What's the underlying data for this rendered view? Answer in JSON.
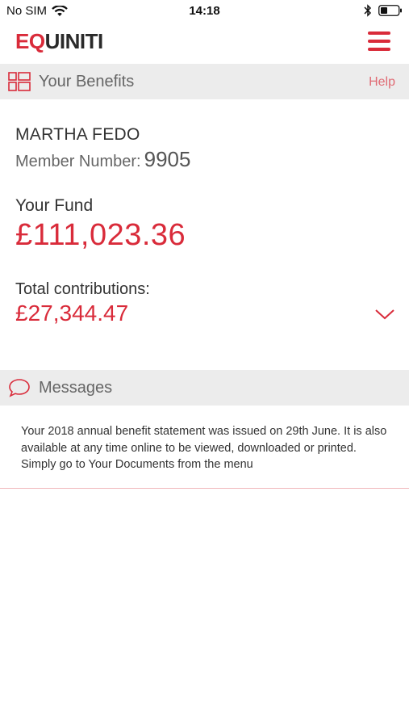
{
  "status_bar": {
    "carrier": "No SIM",
    "time": "14:18"
  },
  "header": {
    "logo_part1": "EQ",
    "logo_part2": "UINITI",
    "menu_icon": "hamburger-menu-icon",
    "brand_color": "#d92b3a"
  },
  "benefits": {
    "icon": "dashboard-grid-icon",
    "title": "Your Benefits",
    "help_label": "Help"
  },
  "member": {
    "name": "MARTHA FEDO",
    "number_label": "Member Number:",
    "number_value": "9905"
  },
  "fund": {
    "label": "Your Fund",
    "value": "£111,023.36"
  },
  "contributions": {
    "label": "Total contributions:",
    "value": "£27,344.47",
    "expand_icon": "chevron-down-icon"
  },
  "messages": {
    "icon": "speech-bubble-icon",
    "title": "Messages",
    "items": [
      {
        "text": "Your 2018 annual benefit statement was issued on 29th June. It is also available at any time online to be viewed, downloaded or printed. Simply go to Your Documents from the menu"
      }
    ]
  }
}
